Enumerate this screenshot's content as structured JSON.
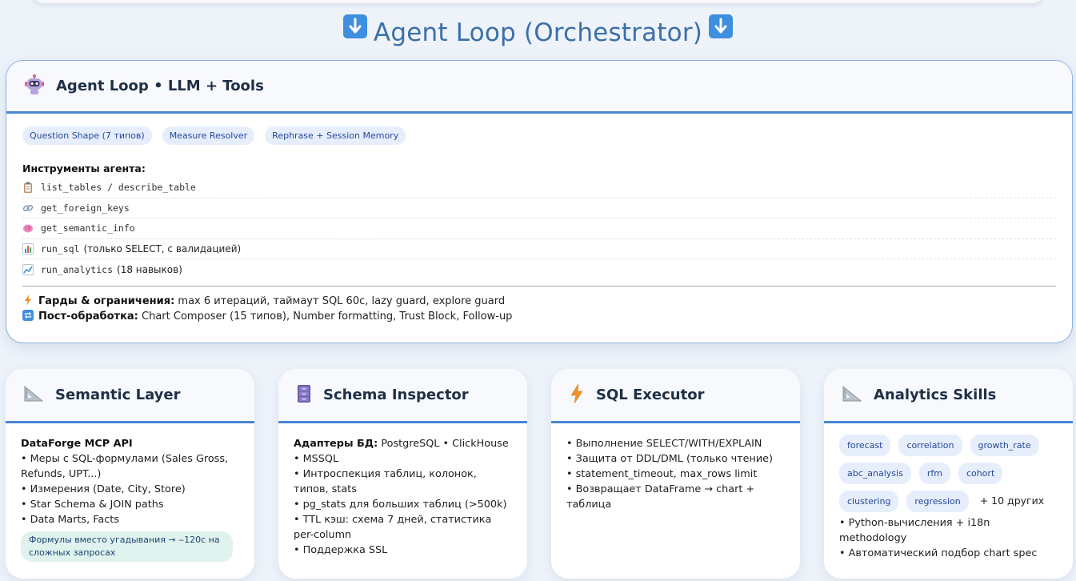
{
  "header": {
    "title": "Agent Loop (Orchestrator)"
  },
  "agent_loop": {
    "title": "Agent Loop • LLM + Tools",
    "pills": [
      "Question Shape (7 типов)",
      "Measure Resolver",
      "Rephrase + Session Memory"
    ],
    "tools_label": "Инструменты агента:",
    "tools": [
      {
        "code": "list_tables / describe_table",
        "note": "",
        "icon": "clipboard-icon"
      },
      {
        "code": "get_foreign_keys",
        "note": "",
        "icon": "link-icon"
      },
      {
        "code": "get_semantic_info",
        "note": "",
        "icon": "brain-icon"
      },
      {
        "code": "run_sql",
        "note": "(только SELECT, с валидацией)",
        "icon": "bar-chart-icon"
      },
      {
        "code": "run_analytics",
        "note": "(18 навыков)",
        "icon": "trend-chart-icon"
      }
    ],
    "guards_label": "Гарды & ограничения:",
    "guards_text": "max 6 итераций, таймаут SQL 60с, lazy guard, explore guard",
    "post_label": "Пост-обработка:",
    "post_text": "Chart Composer (15 типов), Number formatting, Trust Block, Follow-up"
  },
  "semantic_layer": {
    "title": "Semantic Layer",
    "api_label": "DataForge MCP API",
    "lines": [
      "• Меры с SQL-формулами (Sales Gross, Refunds, UPT...)",
      "• Измерения (Date, City, Store)",
      "• Star Schema & JOIN paths",
      "• Data Marts, Facts"
    ],
    "highlight": "Формулы вместо угадывания → ‒120с на сложных запросах"
  },
  "schema_inspector": {
    "title": "Schema Inspector",
    "adapters_label": "Адаптеры БД:",
    "adapters_text": "PostgreSQL • ClickHouse • MSSQL",
    "lines": [
      "• Интроспекция таблиц, колонок, типов, stats",
      "• pg_stats для больших таблиц (>500k)",
      "• TTL кэш: схема 7 дней, статистика per-column",
      "• Поддержка SSL"
    ]
  },
  "sql_executor": {
    "title": "SQL Executor",
    "lines": [
      "• Выполнение SELECT/WITH/EXPLAIN",
      "• Защита от DDL/DML (только чтение)",
      "• statement_timeout, max_rows limit",
      "• Возвращает DataFrame → chart + таблица"
    ]
  },
  "analytics_skills": {
    "title": "Analytics Skills",
    "tags": [
      "forecast",
      "correlation",
      "growth_rate",
      "abc_analysis",
      "rfm",
      "cohort",
      "clustering",
      "regression"
    ],
    "more": "+ 10 других",
    "lines": [
      "• Python-вычисления + i18n methodology",
      "• Автоматический подбор chart spec"
    ]
  },
  "colors": {
    "accent": "#4a86d2",
    "title": "#3b6fa8",
    "pill_bg": "#e7eefb",
    "highlight_bg": "#dff2ee"
  }
}
